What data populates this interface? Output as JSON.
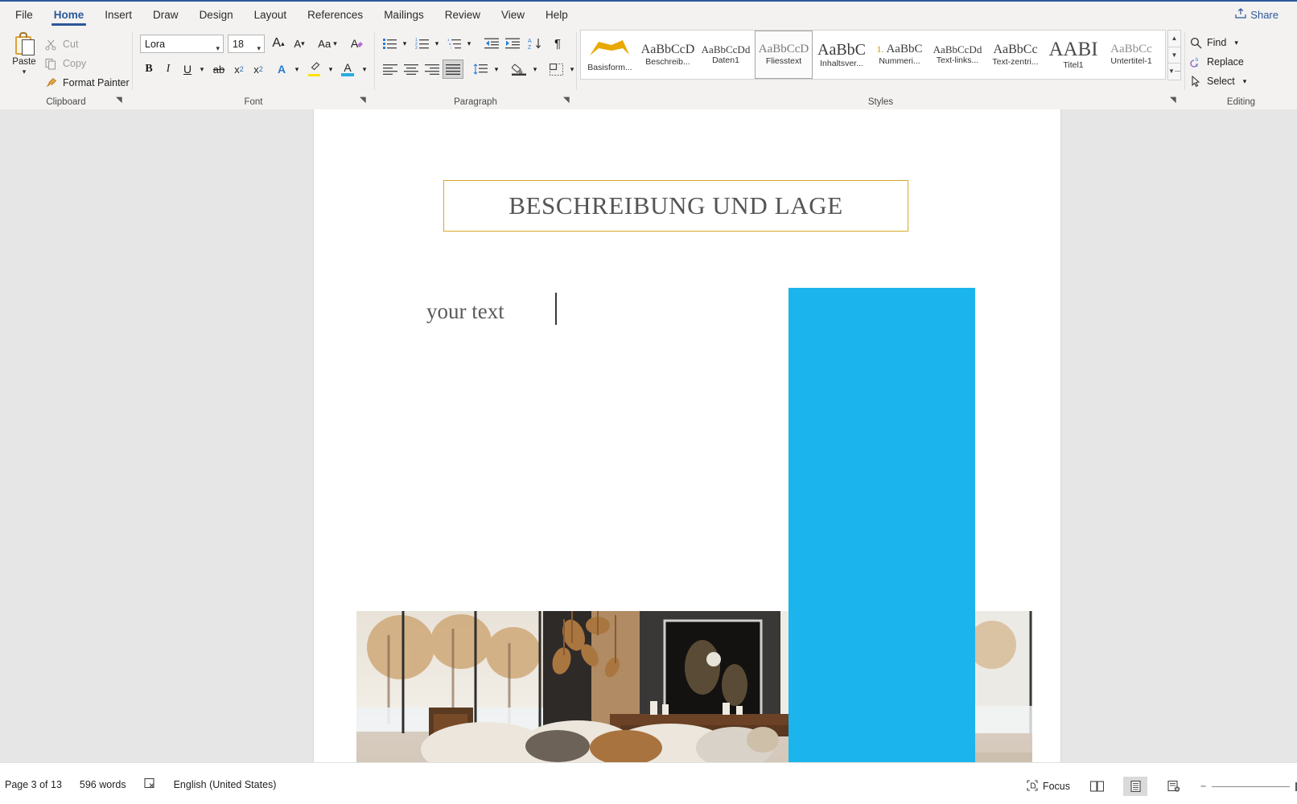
{
  "window": {
    "share_label": "Share"
  },
  "tabs": [
    {
      "label": "File",
      "active": false
    },
    {
      "label": "Home",
      "active": true
    },
    {
      "label": "Insert",
      "active": false
    },
    {
      "label": "Draw",
      "active": false
    },
    {
      "label": "Design",
      "active": false
    },
    {
      "label": "Layout",
      "active": false
    },
    {
      "label": "References",
      "active": false
    },
    {
      "label": "Mailings",
      "active": false
    },
    {
      "label": "Review",
      "active": false
    },
    {
      "label": "View",
      "active": false
    },
    {
      "label": "Help",
      "active": false
    }
  ],
  "clipboard": {
    "group_label": "Clipboard",
    "paste_label": "Paste",
    "cut_label": "Cut",
    "copy_label": "Copy",
    "format_painter_label": "Format Painter"
  },
  "font": {
    "group_label": "Font",
    "font_name": "Lora",
    "font_size": "18",
    "grow_font": "A",
    "shrink_font": "A",
    "change_case": "Aa",
    "clear_formatting": "A",
    "bold": "B",
    "italic": "I",
    "underline": "U",
    "strikethrough": "ab",
    "subscript": "x",
    "superscript": "x",
    "text_effects": "A",
    "highlight": "A",
    "font_color": "A"
  },
  "paragraph": {
    "group_label": "Paragraph"
  },
  "styles": {
    "group_label": "Styles",
    "items": [
      {
        "preview": "",
        "name": "Basisform...",
        "selected": false,
        "swatch": true,
        "size": 18
      },
      {
        "preview": "AaBbCcD",
        "name": "Beschreib...",
        "selected": false,
        "size": 16
      },
      {
        "preview": "AaBbCcDd",
        "name": "Daten1",
        "selected": false,
        "size": 13
      },
      {
        "preview": "AaBbCcD",
        "name": "Fliesstext",
        "selected": true,
        "size": 15
      },
      {
        "preview": "AaBbC",
        "name": "Inhaltsver...",
        "selected": false,
        "size": 20
      },
      {
        "preview": "AaBbC",
        "name": "Nummeri...",
        "selected": false,
        "numbered": "1.",
        "size": 15
      },
      {
        "preview": "AaBbCcDd",
        "name": "Text-links...",
        "selected": false,
        "size": 13
      },
      {
        "preview": "AaBbCc",
        "name": "Text-zentri...",
        "selected": false,
        "size": 16
      },
      {
        "preview": "AABI",
        "name": "Titel1",
        "selected": false,
        "size": 24
      },
      {
        "preview": "AaBbCc",
        "name": "Untertitel-1",
        "selected": false,
        "size": 15
      }
    ]
  },
  "editing": {
    "group_label": "Editing",
    "find_label": "Find",
    "replace_label": "Replace",
    "select_label": "Select"
  },
  "document": {
    "heading": "BESCHREIBUNG UND LAGE",
    "heading_border_color": "#d8a929",
    "body_text": "your text",
    "overlay_color": "#1cb4ec"
  },
  "status": {
    "page_label": "Page 3 of 13",
    "word_count": "596 words",
    "language": "English (United States)",
    "focus_label": "Focus"
  }
}
